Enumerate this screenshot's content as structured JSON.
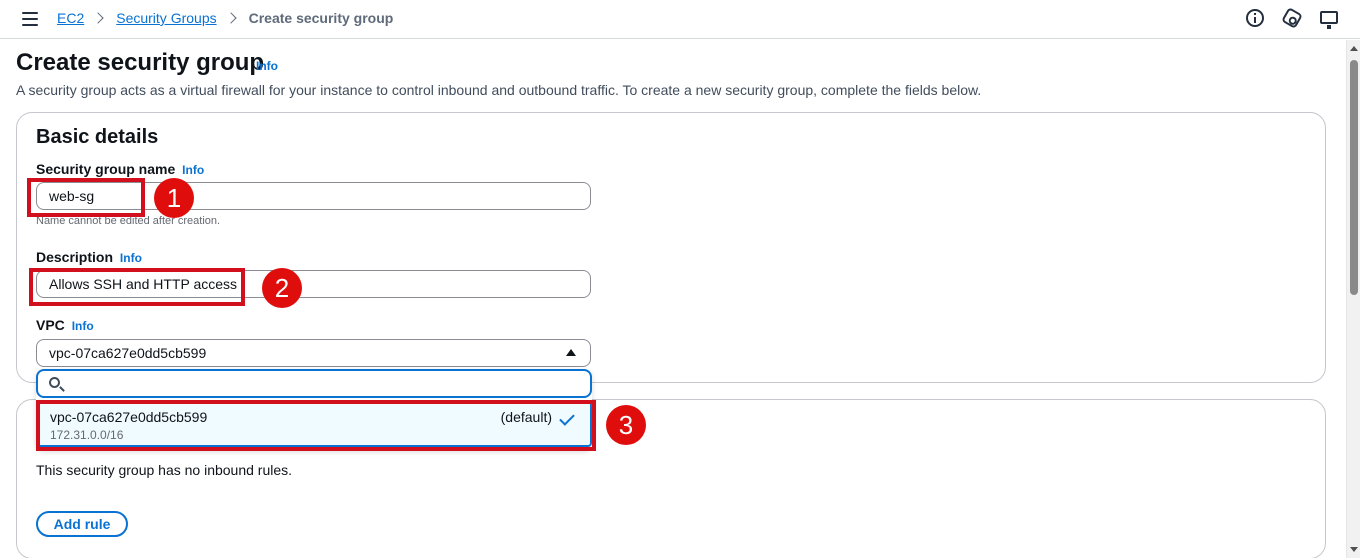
{
  "breadcrumb": {
    "items": [
      "EC2",
      "Security Groups"
    ],
    "current": "Create security group"
  },
  "header": {
    "title": "Create security group",
    "info": "Info",
    "description": "A security group acts as a virtual firewall for your instance to control inbound and outbound traffic. To create a new security group, complete the fields below."
  },
  "basic": {
    "title": "Basic details",
    "name_label": "Security group name",
    "name_info": "Info",
    "name_value": "web-sg",
    "name_hint": "Name cannot be edited after creation.",
    "desc_label": "Description",
    "desc_info": "Info",
    "desc_value": "Allows SSH and HTTP access",
    "vpc_label": "VPC",
    "vpc_info": "Info",
    "vpc_value": "vpc-07ca627e0dd5cb599"
  },
  "dropdown": {
    "search_value": "",
    "options": [
      {
        "id": "vpc-07ca627e0dd5cb599",
        "tag": "(default)",
        "cidr": "172.31.0.0/16",
        "selected": true
      }
    ]
  },
  "inbound": {
    "empty_text": "This security group has no inbound rules.",
    "add_label": "Add rule"
  },
  "annotations": [
    "1",
    "2",
    "3"
  ],
  "icons": {
    "menu": "hamburger-menu-icon",
    "help": "info-circle-icon",
    "notifications": "hexagon-settings-icon",
    "feedback": "screen-feedback-icon",
    "search": "search-icon",
    "check": "check-icon"
  },
  "colors": {
    "link": "#0972d3",
    "highlight": "#d20f1d",
    "badge": "#e00d0d",
    "selected_bg": "#f0fbff"
  }
}
